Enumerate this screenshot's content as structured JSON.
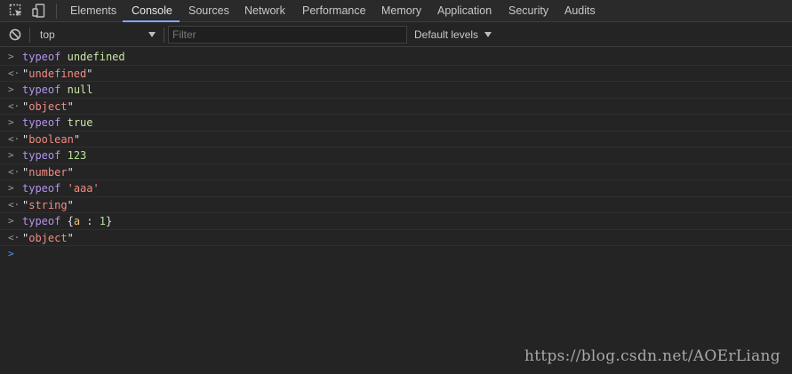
{
  "tabs": [
    {
      "label": "Elements"
    },
    {
      "label": "Console"
    },
    {
      "label": "Sources"
    },
    {
      "label": "Network"
    },
    {
      "label": "Performance"
    },
    {
      "label": "Memory"
    },
    {
      "label": "Application"
    },
    {
      "label": "Security"
    },
    {
      "label": "Audits"
    }
  ],
  "active_tab": "Console",
  "toolbar": {
    "context": "top",
    "filter_placeholder": "Filter",
    "filter_value": "",
    "levels_label": "Default levels"
  },
  "console": {
    "entries": [
      {
        "input_keyword": "typeof",
        "input_value": "undefined",
        "output": "undefined"
      },
      {
        "input_keyword": "typeof",
        "input_value": "null",
        "output": "object"
      },
      {
        "input_keyword": "typeof",
        "input_value": "true",
        "output": "boolean"
      },
      {
        "input_keyword": "typeof",
        "input_value": "123",
        "output": "number"
      },
      {
        "input_keyword": "typeof",
        "input_value": "'aaa'",
        "output": "string"
      },
      {
        "input_keyword": "typeof",
        "input_value_parts": [
          "{",
          "a",
          " : ",
          "1",
          "}"
        ],
        "output": "object"
      }
    ]
  },
  "watermark": "https://blog.csdn.net/AOErLiang",
  "colors": {
    "background": "#242424",
    "active_tab_underline": "#7cacf8",
    "keyword": "#b392f0",
    "string_result": "#f28b82",
    "prompt": "#4d9cf0"
  }
}
